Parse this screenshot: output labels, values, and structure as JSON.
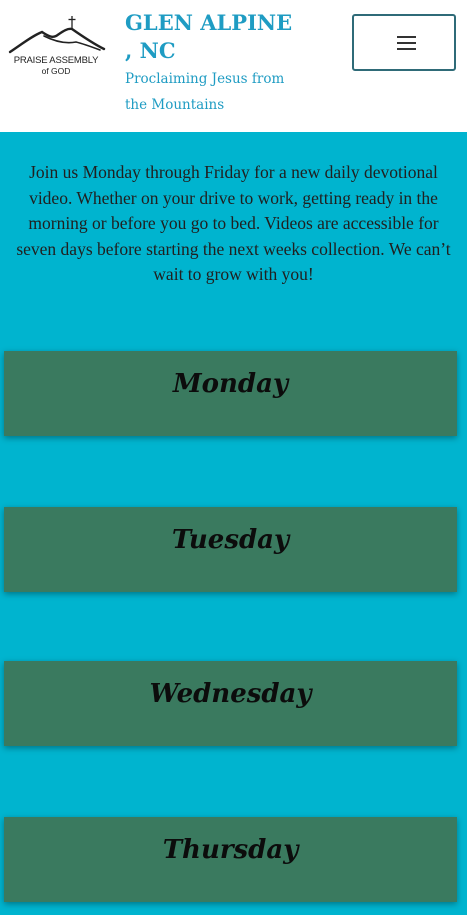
{
  "header": {
    "logo": {
      "line1": "PRAISE ASSEMBLY",
      "line2": "of GOD"
    },
    "title": "GLEN ALPINE , NC",
    "tagline": "Proclaiming Jesus from the Mountains",
    "menu_icon": "hamburger-icon"
  },
  "intro": "Join us Monday through Friday for a new daily devotional video. Whether on your drive to work, getting ready in the morning or before you go to bed. Videos are accessible for seven days before starting the next weeks collection. We can’t wait to grow with you!",
  "days": [
    {
      "label": "Monday"
    },
    {
      "label": "Tuesday"
    },
    {
      "label": "Wednesday"
    },
    {
      "label": "Thursday"
    }
  ],
  "colors": {
    "background": "#00b4cf",
    "header_bg": "#ffffff",
    "title": "#1f9cc3",
    "card": "#3a7a5f"
  }
}
